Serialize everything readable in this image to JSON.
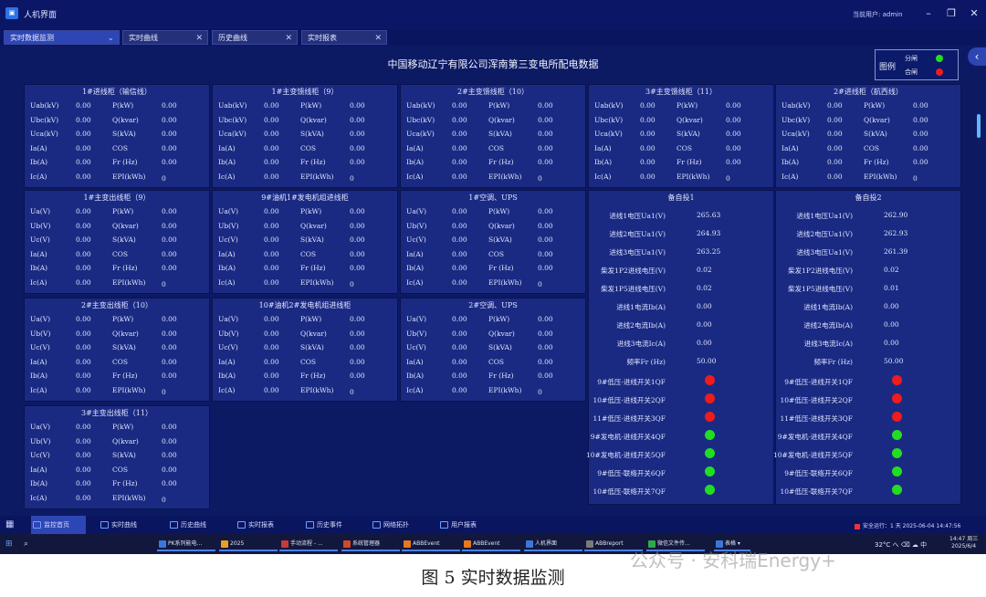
{
  "window": {
    "title": "人机界面",
    "user": "当前用户: admin"
  },
  "tabs": [
    {
      "label": "实时数据监测",
      "close": "⌄",
      "active": true
    },
    {
      "label": "实时曲线",
      "close": "✕"
    },
    {
      "label": "历史曲线",
      "close": "✕"
    },
    {
      "label": "实时报表",
      "close": "✕"
    }
  ],
  "page_title": "中国移动辽宁有限公司浑南第三变电所配电数据",
  "legend": {
    "title": "图例",
    "open_label": "分闸",
    "close_label": "合闸",
    "open_color": "#22dd22",
    "close_color": "#ee1c1c"
  },
  "panels_a": [
    {
      "title": "1#进线柜（输信线）",
      "rows": [
        [
          "Uab(kV)",
          "0.00",
          "P(kW)",
          "0.00"
        ],
        [
          "Ubc(kV)",
          "0.00",
          "Q(kvar)",
          "0.00"
        ],
        [
          "Uca(kV)",
          "0.00",
          "S(kVA)",
          "0.00"
        ],
        [
          "Ia(A)",
          "0.00",
          "COS",
          "0.00"
        ],
        [
          "Ib(A)",
          "0.00",
          "Fr (Hz)",
          "0.00"
        ],
        [
          "Ic(A)",
          "0.00",
          "EPI(kWh)",
          "0"
        ]
      ]
    },
    {
      "title": "1#主变馈线柜（9）",
      "rows": [
        [
          "Uab(kV)",
          "0.00",
          "P(kW)",
          "0.00"
        ],
        [
          "Ubc(kV)",
          "0.00",
          "Q(kvar)",
          "0.00"
        ],
        [
          "Uca(kV)",
          "0.00",
          "S(kVA)",
          "0.00"
        ],
        [
          "Ia(A)",
          "0.00",
          "COS",
          "0.00"
        ],
        [
          "Ib(A)",
          "0.00",
          "Fr (Hz)",
          "0.00"
        ],
        [
          "Ic(A)",
          "0.00",
          "EPI(kWh)",
          "0"
        ]
      ]
    },
    {
      "title": "2#主变馈线柜（10）",
      "rows": [
        [
          "Uab(kV)",
          "0.00",
          "P(kW)",
          "0.00"
        ],
        [
          "Ubc(kV)",
          "0.00",
          "Q(kvar)",
          "0.00"
        ],
        [
          "Uca(kV)",
          "0.00",
          "S(kVA)",
          "0.00"
        ],
        [
          "Ia(A)",
          "0.00",
          "COS",
          "0.00"
        ],
        [
          "Ib(A)",
          "0.00",
          "Fr (Hz)",
          "0.00"
        ],
        [
          "Ic(A)",
          "0.00",
          "EPI(kWh)",
          "0"
        ]
      ]
    },
    {
      "title": "3#主变馈线柜（11）",
      "rows": [
        [
          "Uab(kV)",
          "0.00",
          "P(kW)",
          "0.00"
        ],
        [
          "Ubc(kV)",
          "0.00",
          "Q(kvar)",
          "0.00"
        ],
        [
          "Uca(kV)",
          "0.00",
          "S(kVA)",
          "0.00"
        ],
        [
          "Ia(A)",
          "0.00",
          "COS",
          "0.00"
        ],
        [
          "Ib(A)",
          "0.00",
          "Fr (Hz)",
          "0.00"
        ],
        [
          "Ic(A)",
          "0.00",
          "EPI(kWh)",
          "0"
        ]
      ]
    },
    {
      "title": "2#进线柜（航西线）",
      "rows": [
        [
          "Uab(kV)",
          "0.00",
          "P(kW)",
          "0.00"
        ],
        [
          "Ubc(kV)",
          "0.00",
          "Q(kvar)",
          "0.00"
        ],
        [
          "Uca(kV)",
          "0.00",
          "S(kVA)",
          "0.00"
        ],
        [
          "Ia(A)",
          "0.00",
          "COS",
          "0.00"
        ],
        [
          "Ib(A)",
          "0.00",
          "Fr (Hz)",
          "0.00"
        ],
        [
          "Ic(A)",
          "0.00",
          "EPI(kWh)",
          "0"
        ]
      ]
    }
  ],
  "panels_b": [
    {
      "title": "1#主变出线柜（9）",
      "rows": [
        [
          "Ua(V)",
          "0.00",
          "P(kW)",
          "0.00"
        ],
        [
          "Ub(V)",
          "0.00",
          "Q(kvar)",
          "0.00"
        ],
        [
          "Uc(V)",
          "0.00",
          "S(kVA)",
          "0.00"
        ],
        [
          "Ia(A)",
          "0.00",
          "COS",
          "0.00"
        ],
        [
          "Ib(A)",
          "0.00",
          "Fr (Hz)",
          "0.00"
        ],
        [
          "Ic(A)",
          "0.00",
          "EPI(kWh)",
          "0"
        ]
      ]
    },
    {
      "title": "9#油机1#发电机组进线柜",
      "rows": [
        [
          "Ua(V)",
          "0.00",
          "P(kW)",
          "0.00"
        ],
        [
          "Ub(V)",
          "0.00",
          "Q(kvar)",
          "0.00"
        ],
        [
          "Uc(V)",
          "0.00",
          "S(kVA)",
          "0.00"
        ],
        [
          "Ia(A)",
          "0.00",
          "COS",
          "0.00"
        ],
        [
          "Ib(A)",
          "0.00",
          "Fr (Hz)",
          "0.00"
        ],
        [
          "Ic(A)",
          "0.00",
          "EPI(kWh)",
          "0"
        ]
      ]
    },
    {
      "title": "1#空调、UPS",
      "rows": [
        [
          "Ua(V)",
          "0.00",
          "P(kW)",
          "0.00"
        ],
        [
          "Ub(V)",
          "0.00",
          "Q(kvar)",
          "0.00"
        ],
        [
          "Uc(V)",
          "0.00",
          "S(kVA)",
          "0.00"
        ],
        [
          "Ia(A)",
          "0.00",
          "COS",
          "0.00"
        ],
        [
          "Ib(A)",
          "0.00",
          "Fr (Hz)",
          "0.00"
        ],
        [
          "Ic(A)",
          "0.00",
          "EPI(kWh)",
          "0"
        ]
      ]
    },
    {
      "title": "2#主变出线柜（10）",
      "rows": [
        [
          "Ua(V)",
          "0.00",
          "P(kW)",
          "0.00"
        ],
        [
          "Ub(V)",
          "0.00",
          "Q(kvar)",
          "0.00"
        ],
        [
          "Uc(V)",
          "0.00",
          "S(kVA)",
          "0.00"
        ],
        [
          "Ia(A)",
          "0.00",
          "COS",
          "0.00"
        ],
        [
          "Ib(A)",
          "0.00",
          "Fr (Hz)",
          "0.00"
        ],
        [
          "Ic(A)",
          "0.00",
          "EPI(kWh)",
          "0"
        ]
      ]
    },
    {
      "title": "10#油机2#发电机组进线柜",
      "rows": [
        [
          "Ua(V)",
          "0.00",
          "P(kW)",
          "0.00"
        ],
        [
          "Ub(V)",
          "0.00",
          "Q(kvar)",
          "0.00"
        ],
        [
          "Uc(V)",
          "0.00",
          "S(kVA)",
          "0.00"
        ],
        [
          "Ia(A)",
          "0.00",
          "COS",
          "0.00"
        ],
        [
          "Ib(A)",
          "0.00",
          "Fr (Hz)",
          "0.00"
        ],
        [
          "Ic(A)",
          "0.00",
          "EPI(kWh)",
          "0"
        ]
      ]
    },
    {
      "title": "2#空调、UPS",
      "rows": [
        [
          "Ua(V)",
          "0.00",
          "P(kW)",
          "0.00"
        ],
        [
          "Ub(V)",
          "0.00",
          "Q(kvar)",
          "0.00"
        ],
        [
          "Uc(V)",
          "0.00",
          "S(kVA)",
          "0.00"
        ],
        [
          "Ia(A)",
          "0.00",
          "COS",
          "0.00"
        ],
        [
          "Ib(A)",
          "0.00",
          "Fr (Hz)",
          "0.00"
        ],
        [
          "Ic(A)",
          "0.00",
          "EPI(kWh)",
          "0"
        ]
      ]
    },
    {
      "title": "3#主变出线柜（11）",
      "rows": [
        [
          "Ua(V)",
          "0.00",
          "P(kW)",
          "0.00"
        ],
        [
          "Ub(V)",
          "0.00",
          "Q(kvar)",
          "0.00"
        ],
        [
          "Uc(V)",
          "0.00",
          "S(kVA)",
          "0.00"
        ],
        [
          "Ia(A)",
          "0.00",
          "COS",
          "0.00"
        ],
        [
          "Ib(A)",
          "0.00",
          "Fr (Hz)",
          "0.00"
        ],
        [
          "Ic(A)",
          "0.00",
          "EPI(kWh)",
          "0"
        ]
      ]
    }
  ],
  "backups": [
    {
      "title": "备自投1",
      "values": [
        [
          "进线1电压Ua1(V)",
          "265.63"
        ],
        [
          "进线2电压Ua1(V)",
          "264.93"
        ],
        [
          "进线3电压Ua1(V)",
          "263.25"
        ],
        [
          "柴发1P2进线电压(V)",
          "0.02"
        ],
        [
          "柴发1P5进线电压(V)",
          "0.02"
        ],
        [
          "进线1电流Ib(A)",
          "0.00"
        ],
        [
          "进线2电流Ib(A)",
          "0.00"
        ],
        [
          "进线3电流Ic(A)",
          "0.00"
        ],
        [
          "频率Fr (Hz)",
          "50.00"
        ]
      ],
      "switches": [
        [
          "9#低压-进线开关1QF",
          "red"
        ],
        [
          "10#低压-进线开关2QF",
          "red"
        ],
        [
          "11#低压-进线开关3QF",
          "red"
        ],
        [
          "9#发电机-进线开关4QF",
          "green"
        ],
        [
          "10#发电机-进线开关5QF",
          "green"
        ],
        [
          "9#低压-联络开关6QF",
          "green"
        ],
        [
          "10#低压-联络开关7QF",
          "green"
        ]
      ]
    },
    {
      "title": "备自投2",
      "values": [
        [
          "进线1电压Ua1(V)",
          "262.90"
        ],
        [
          "进线2电压Ua1(V)",
          "262.93"
        ],
        [
          "进线3电压Ua1(V)",
          "261.39"
        ],
        [
          "柴发1P2进线电压(V)",
          "0.02"
        ],
        [
          "柴发1P5进线电压(V)",
          "0.01"
        ],
        [
          "进线1电流Ib(A)",
          "0.00"
        ],
        [
          "进线2电流Ib(A)",
          "0.00"
        ],
        [
          "进线3电流Ic(A)",
          "0.00"
        ],
        [
          "频率Fr (Hz)",
          "50.00"
        ]
      ],
      "switches": [
        [
          "9#低压-进线开关1QF",
          "red"
        ],
        [
          "10#低压-进线开关2QF",
          "red"
        ],
        [
          "11#低压-进线开关3QF",
          "red"
        ],
        [
          "9#发电机-进线开关4QF",
          "green"
        ],
        [
          "10#发电机-进线开关5QF",
          "green"
        ],
        [
          "9#低压-联络开关6QF",
          "green"
        ],
        [
          "10#低压-联络开关7QF",
          "green"
        ]
      ]
    }
  ],
  "nav": [
    "监控首页",
    "实时曲线",
    "历史曲线",
    "实时报表",
    "历史事件",
    "网络拓扑",
    "用户报表"
  ],
  "status": "安全运行：1 天   2025-06-04 14:47:56",
  "taskbar": {
    "apps": [
      "PK系列能电...",
      "2025",
      "手动流程 - ...",
      "系统管理器",
      "ABBEvent",
      "ABBEvent",
      "人机界面",
      "ABBreport",
      "微信文件传...",
      "表格 ▾"
    ],
    "weather": "32°C",
    "tray": "へ ⌫ ☁ 中",
    "time": "14:47 周三",
    "date": "2025/6/4"
  },
  "caption": "图 5    实时数据监测",
  "watermark": "公众号 · 安科瑞Energy+"
}
